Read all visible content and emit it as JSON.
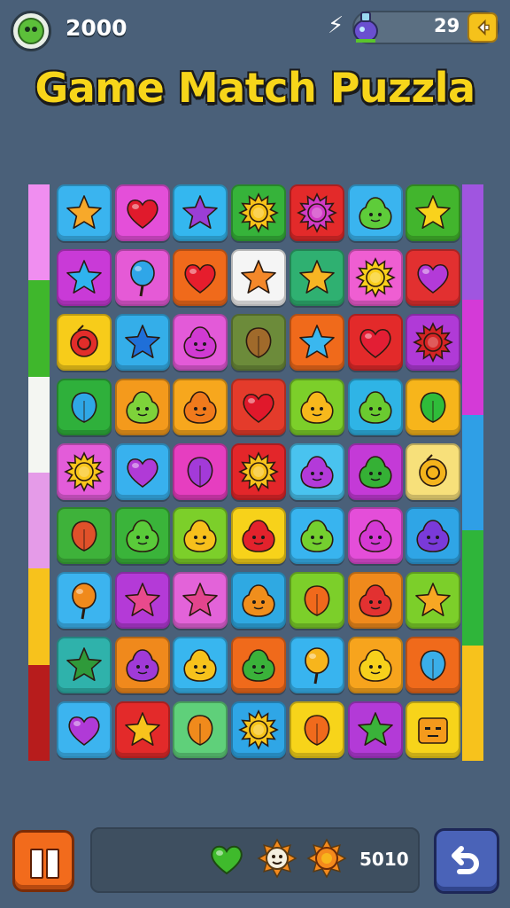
{
  "header": {
    "coins": "2000",
    "energy": "29",
    "title": "Game Match Puzzla"
  },
  "footer": {
    "score": "5010"
  },
  "board": {
    "rows": 9,
    "cols": 7,
    "tiles": [
      [
        {
          "bg": "#3ab4ef",
          "icon": "star",
          "color": "#f7a92a"
        },
        {
          "bg": "#e44fd9",
          "icon": "heart",
          "color": "#e01a2c"
        },
        {
          "bg": "#34b7ef",
          "icon": "star",
          "color": "#9b3ed6"
        },
        {
          "bg": "#36b33a",
          "icon": "sun",
          "color": "#f8c31a"
        },
        {
          "bg": "#e32a2a",
          "icon": "sun",
          "color": "#d13bc5"
        },
        {
          "bg": "#3ab4ef",
          "icon": "blob",
          "color": "#5ecc3a"
        },
        {
          "bg": "#42b52d",
          "icon": "star",
          "color": "#f9d21c"
        }
      ],
      [
        {
          "bg": "#c93ad7",
          "icon": "star",
          "color": "#2fb3ef"
        },
        {
          "bg": "#e55ad6",
          "icon": "balloon",
          "color": "#2fa6e8"
        },
        {
          "bg": "#f06a1b",
          "icon": "heart",
          "color": "#e61d2d"
        },
        {
          "bg": "#f5f5f5",
          "icon": "star",
          "color": "#f4882a"
        },
        {
          "bg": "#2fb071",
          "icon": "star",
          "color": "#f7b523"
        },
        {
          "bg": "#ef5ed2",
          "icon": "sun",
          "color": "#f9cf1c"
        },
        {
          "bg": "#e23030",
          "icon": "heart",
          "color": "#b33ad8"
        }
      ],
      [
        {
          "bg": "#f7cc1a",
          "icon": "ring",
          "color": "#e22d2a"
        },
        {
          "bg": "#34aee9",
          "icon": "star",
          "color": "#1f6fd8"
        },
        {
          "bg": "#e35ad8",
          "icon": "blob",
          "color": "#d03ad2"
        },
        {
          "bg": "#6c8b3a",
          "icon": "leaf",
          "color": "#a06a2b"
        },
        {
          "bg": "#f06a1b",
          "icon": "star",
          "color": "#3ab7ef"
        },
        {
          "bg": "#e32a2a",
          "icon": "heart",
          "color": "#e31e34"
        },
        {
          "bg": "#b03ad7",
          "icon": "sun",
          "color": "#d42424"
        }
      ],
      [
        {
          "bg": "#2fb03b",
          "icon": "leaf",
          "color": "#2fa7e6"
        },
        {
          "bg": "#f49a1c",
          "icon": "blob",
          "color": "#7ed23a"
        },
        {
          "bg": "#f7a71d",
          "icon": "blob",
          "color": "#f07a1c"
        },
        {
          "bg": "#e43b2b",
          "icon": "heart",
          "color": "#e0182b"
        },
        {
          "bg": "#7ccf2a",
          "icon": "blob",
          "color": "#f7b81c"
        },
        {
          "bg": "#2fb4e6",
          "icon": "blob",
          "color": "#6acb30"
        },
        {
          "bg": "#f7b51b",
          "icon": "leaf",
          "color": "#2fbc3a"
        }
      ],
      [
        {
          "bg": "#e35cd9",
          "icon": "sun",
          "color": "#f9c51c"
        },
        {
          "bg": "#38b1ee",
          "icon": "heart",
          "color": "#b03ad7"
        },
        {
          "bg": "#e63ec0",
          "icon": "leaf",
          "color": "#a33ad9"
        },
        {
          "bg": "#e3262a",
          "icon": "sun",
          "color": "#f7c21c"
        },
        {
          "bg": "#49c3ef",
          "icon": "blob",
          "color": "#b33ad9"
        },
        {
          "bg": "#c43ad7",
          "icon": "blob",
          "color": "#35b035"
        },
        {
          "bg": "#f7e07a",
          "icon": "ring",
          "color": "#f4b41c"
        }
      ],
      [
        {
          "bg": "#3eb23a",
          "icon": "leaf",
          "color": "#e0512a"
        },
        {
          "bg": "#3ab43a",
          "icon": "blob",
          "color": "#5acb3a"
        },
        {
          "bg": "#7ccf2a",
          "icon": "blob",
          "color": "#f7c01c"
        },
        {
          "bg": "#f7d21a",
          "icon": "blob",
          "color": "#e2222c"
        },
        {
          "bg": "#38b4ef",
          "icon": "blob",
          "color": "#74cf2f"
        },
        {
          "bg": "#e44ed9",
          "icon": "blob",
          "color": "#d53ad4"
        },
        {
          "bg": "#2fa5e6",
          "icon": "blob",
          "color": "#7a3ad9"
        }
      ],
      [
        {
          "bg": "#3cb4ef",
          "icon": "balloon",
          "color": "#f08a1c"
        },
        {
          "bg": "#b43ad7",
          "icon": "star",
          "color": "#e84a8c"
        },
        {
          "bg": "#e363d9",
          "icon": "star",
          "color": "#e2458d"
        },
        {
          "bg": "#2fa9e2",
          "icon": "blob",
          "color": "#f08e1c"
        },
        {
          "bg": "#7ccf2a",
          "icon": "leaf",
          "color": "#f0691c"
        },
        {
          "bg": "#f08a1c",
          "icon": "blob",
          "color": "#e23131"
        },
        {
          "bg": "#7ccf2a",
          "icon": "star",
          "color": "#f7a723"
        }
      ],
      [
        {
          "bg": "#2fb2ab",
          "icon": "star",
          "color": "#2f9a3a"
        },
        {
          "bg": "#f0891c",
          "icon": "blob",
          "color": "#a03ad7"
        },
        {
          "bg": "#38b6ef",
          "icon": "blob",
          "color": "#f7c21c"
        },
        {
          "bg": "#f06a1b",
          "icon": "blob",
          "color": "#3ab23a"
        },
        {
          "bg": "#38b4ef",
          "icon": "balloon",
          "color": "#f7b51c"
        },
        {
          "bg": "#f7a41d",
          "icon": "blob",
          "color": "#f7d11c"
        },
        {
          "bg": "#f06a1b",
          "icon": "leaf",
          "color": "#3aaee9"
        }
      ],
      [
        {
          "bg": "#3cb4ef",
          "icon": "heart",
          "color": "#b03ad7"
        },
        {
          "bg": "#e32a2a",
          "icon": "star",
          "color": "#f7c31c"
        },
        {
          "bg": "#5fd07a",
          "icon": "leaf",
          "color": "#f08a1c"
        },
        {
          "bg": "#2fa6e6",
          "icon": "sun",
          "color": "#f7c51c"
        },
        {
          "bg": "#f7d41a",
          "icon": "leaf",
          "color": "#f06a1c"
        },
        {
          "bg": "#b33ad7",
          "icon": "star",
          "color": "#3ab23a"
        },
        {
          "bg": "#f7d41a",
          "icon": "box",
          "color": "#f49a1c"
        }
      ]
    ]
  },
  "left_bar_colors": [
    "#f08ef0",
    "#3fb72c",
    "#f4f6f2",
    "#e59be8",
    "#f7c21c",
    "#b71c1c"
  ],
  "right_bar_colors": [
    "#a055e0",
    "#d43ad7",
    "#2f9fe6",
    "#2fb53a",
    "#f7c21c"
  ],
  "tray": {
    "heart_color": "#3fba2c",
    "sun_colors": [
      "#f5f0e0",
      "#f48a1c"
    ]
  }
}
